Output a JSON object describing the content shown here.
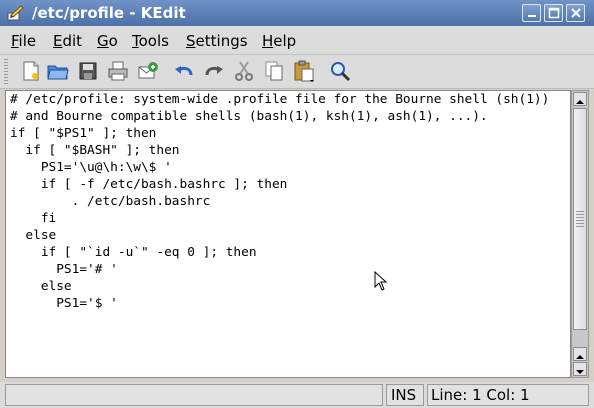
{
  "window": {
    "title": "/etc/profile - KEdit"
  },
  "menu": {
    "items": [
      "File",
      "Edit",
      "Go",
      "Tools",
      "Settings",
      "Help"
    ]
  },
  "toolbar": {
    "buttons": [
      "new-document-icon",
      "open-folder-icon",
      "save-disk-icon",
      "print-icon",
      "send-mail-icon",
      "undo-icon",
      "redo-icon",
      "cut-scissors-icon",
      "copy-icon",
      "paste-icon",
      "find-magnifier-icon"
    ]
  },
  "editor": {
    "lines": [
      "# /etc/profile: system-wide .profile file for the Bourne shell (sh(1))",
      "# and Bourne compatible shells (bash(1), ksh(1), ash(1), ...).",
      "",
      "if [ \"$PS1\" ]; then",
      "  if [ \"$BASH\" ]; then",
      "    PS1='\\u@\\h:\\w\\$ '",
      "    if [ -f /etc/bash.bashrc ]; then",
      "        . /etc/bash.bashrc",
      "    fi",
      "  else",
      "    if [ \"`id -u`\" -eq 0 ]; then",
      "      PS1='# '",
      "    else",
      "      PS1='$ '"
    ]
  },
  "status": {
    "message": "",
    "mode": "INS",
    "position": "Line: 1 Col: 1"
  }
}
